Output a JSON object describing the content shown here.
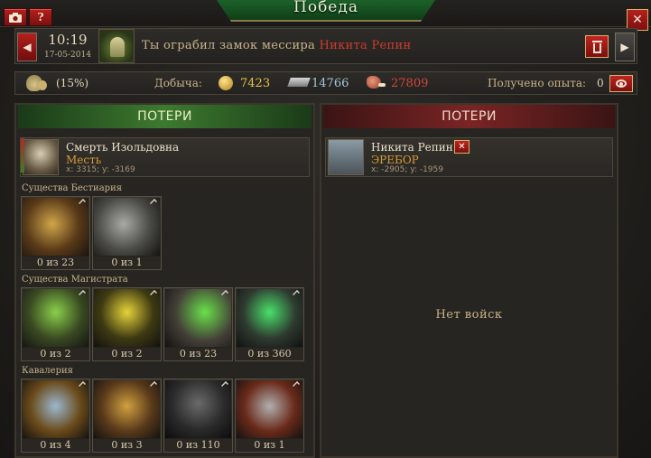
{
  "header": {
    "title": "Победа",
    "camera_icon": "camera-icon",
    "help_label": "?",
    "close_label": "✕"
  },
  "report": {
    "time": "10:19",
    "date": "17-05-2014",
    "text_prefix": "Ты ограбил замок мессира",
    "target_name": "Никита Репин",
    "prev_label": "◀",
    "next_label": "▶"
  },
  "loot": {
    "percent": "(15%)",
    "label": "Добыча:",
    "gold": "7423",
    "iron": "14766",
    "meat": "27809",
    "xp_label": "Получено опыта:",
    "xp_value": "0"
  },
  "left": {
    "header": "ПОТЕРИ",
    "hero": {
      "name": "Смерть Изольдовна",
      "castle": "Месть",
      "coords": "x: 3315; y: -3169"
    },
    "sections": [
      {
        "label": "Существа Бестиария",
        "units": [
          {
            "count": "0 из 23"
          },
          {
            "count": "0 из 1"
          }
        ]
      },
      {
        "label": "Существа Магистрата",
        "units": [
          {
            "count": "0 из 2"
          },
          {
            "count": "0 из 2"
          },
          {
            "count": "0 из 23"
          },
          {
            "count": "0 из 360"
          }
        ]
      },
      {
        "label": "Кавалерия",
        "units": [
          {
            "count": "0 из 4"
          },
          {
            "count": "0 из 3"
          },
          {
            "count": "0 из 110"
          },
          {
            "count": "0 из 1"
          }
        ]
      }
    ]
  },
  "right": {
    "header": "ПОТЕРИ",
    "hero": {
      "name": "Никита Репин",
      "castle": "ЭРЕБОР",
      "coords": "x: -2905; y: -1959",
      "remove_label": "✕"
    },
    "no_troops": "Нет войск"
  },
  "colors": {
    "accent_red": "#b4201d",
    "gold": "#e8c14a",
    "target_red": "#d23a2d",
    "castle_orange": "#d69b3a"
  }
}
